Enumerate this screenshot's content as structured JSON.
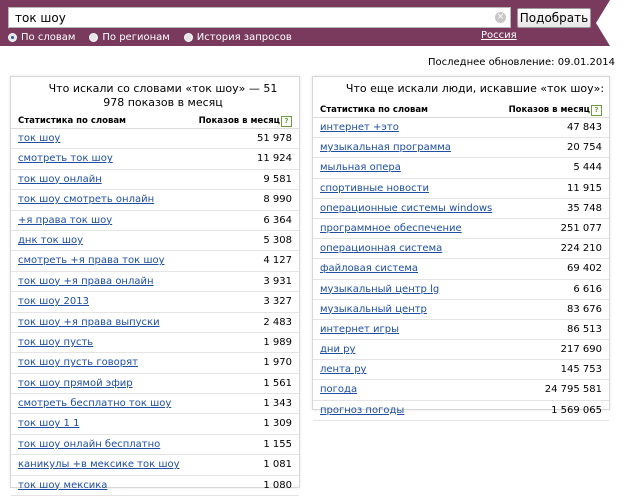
{
  "search": {
    "value": "ток шоу",
    "button_label": "Подобрать",
    "clear_glyph": "×"
  },
  "modes": [
    {
      "label": "По словам",
      "selected": true
    },
    {
      "label": "По регионам",
      "selected": false
    },
    {
      "label": "История запросов",
      "selected": false
    }
  ],
  "region": "Россия",
  "updated": "Последнее обновление: 09.01.2014",
  "left": {
    "title": "Что искали со словами «ток шоу» — 51 978 показов в месяц",
    "col_words": "Статистика по словам",
    "col_shows": "Показов в месяц",
    "help": "?",
    "rows": [
      {
        "q": "ток шоу",
        "n": "51 978"
      },
      {
        "q": "смотреть ток шоу",
        "n": "11 924"
      },
      {
        "q": "ток шоу онлайн",
        "n": "9 581"
      },
      {
        "q": "ток шоу смотреть онлайн",
        "n": "8 990"
      },
      {
        "q": "+я права ток шоу",
        "n": "6 364"
      },
      {
        "q": "днк ток шоу",
        "n": "5 308"
      },
      {
        "q": "смотреть +я права ток шоу",
        "n": "4 127"
      },
      {
        "q": "ток шоу +я права онлайн",
        "n": "3 931"
      },
      {
        "q": "ток шоу 2013",
        "n": "3 327"
      },
      {
        "q": "ток шоу +я права выпуски",
        "n": "2 483"
      },
      {
        "q": "ток шоу пусть",
        "n": "1 989"
      },
      {
        "q": "ток шоу пусть говорят",
        "n": "1 970"
      },
      {
        "q": "ток шоу прямой эфир",
        "n": "1 561"
      },
      {
        "q": "смотреть бесплатно ток шоу",
        "n": "1 343"
      },
      {
        "q": "ток шоу 1 1",
        "n": "1 309"
      },
      {
        "q": "ток шоу онлайн бесплатно",
        "n": "1 155"
      },
      {
        "q": "каникулы +в мексике ток шоу",
        "n": "1 081"
      },
      {
        "q": "ток шоу мексика",
        "n": "1 080"
      }
    ]
  },
  "right": {
    "title": "Что еще искали люди, искавшие «ток шоу»:",
    "col_words": "Статистика по словам",
    "col_shows": "Показов в месяц",
    "help": "?",
    "rows": [
      {
        "q": "интернет +это",
        "n": "47 843"
      },
      {
        "q": "музыкальная программа",
        "n": "20 754"
      },
      {
        "q": "мыльная опера",
        "n": "5 444"
      },
      {
        "q": "спортивные новости",
        "n": "11 915"
      },
      {
        "q": "операционные системы windows",
        "n": "35 748"
      },
      {
        "q": "программное обеспечение",
        "n": "251 077"
      },
      {
        "q": "операционная система",
        "n": "224 210"
      },
      {
        "q": "файловая система",
        "n": "69 402"
      },
      {
        "q": "музыкальный центр lg",
        "n": "6 616"
      },
      {
        "q": "музыкальный центр",
        "n": "83 676"
      },
      {
        "q": "интернет игры",
        "n": "86 513"
      },
      {
        "q": "дни ру",
        "n": "217 690"
      },
      {
        "q": "лента ру",
        "n": "145 753"
      },
      {
        "q": "погода",
        "n": "24 795 581"
      },
      {
        "q": "прогноз погоды",
        "n": "1 569 065"
      }
    ]
  },
  "colors": {
    "bar": "#7a3a5e",
    "link": "#1f4ea3"
  }
}
